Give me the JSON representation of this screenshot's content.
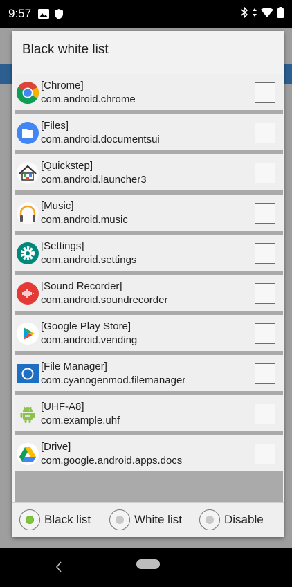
{
  "status_bar": {
    "time": "9:57"
  },
  "dialog": {
    "title": "Black white list",
    "apps": [
      {
        "name": "[Chrome]",
        "package": "com.android.chrome",
        "icon": "chrome-icon",
        "checked": false
      },
      {
        "name": "[Files]",
        "package": "com.android.documentsui",
        "icon": "files-icon",
        "checked": false
      },
      {
        "name": "[Quickstep]",
        "package": "com.android.launcher3",
        "icon": "launcher-house-icon",
        "checked": false
      },
      {
        "name": "[Music]",
        "package": "com.android.music",
        "icon": "headphones-icon",
        "checked": false
      },
      {
        "name": "[Settings]",
        "package": "com.android.settings",
        "icon": "settings-gear-icon",
        "checked": false
      },
      {
        "name": "[Sound Recorder]",
        "package": "com.android.soundrecorder",
        "icon": "sound-recorder-icon",
        "checked": false
      },
      {
        "name": "[Google Play Store]",
        "package": "com.android.vending",
        "icon": "play-store-icon",
        "checked": false
      },
      {
        "name": "[File Manager]",
        "package": "com.cyanogenmod.filemanager",
        "icon": "file-manager-icon",
        "checked": false
      },
      {
        "name": "[UHF-A8]",
        "package": "com.example.uhf",
        "icon": "android-robot-icon",
        "checked": false
      },
      {
        "name": "[Drive]",
        "package": "com.google.android.apps.docs",
        "icon": "drive-icon",
        "checked": false
      }
    ],
    "modes": {
      "selected": "black",
      "black_label": "Black list",
      "white_label": "White list",
      "disable_label": "Disable"
    }
  },
  "colors": {
    "dialog_bg": "#f2f2f2",
    "radio_selected": "#7ec63b",
    "header_blue": "#2c5f90"
  }
}
